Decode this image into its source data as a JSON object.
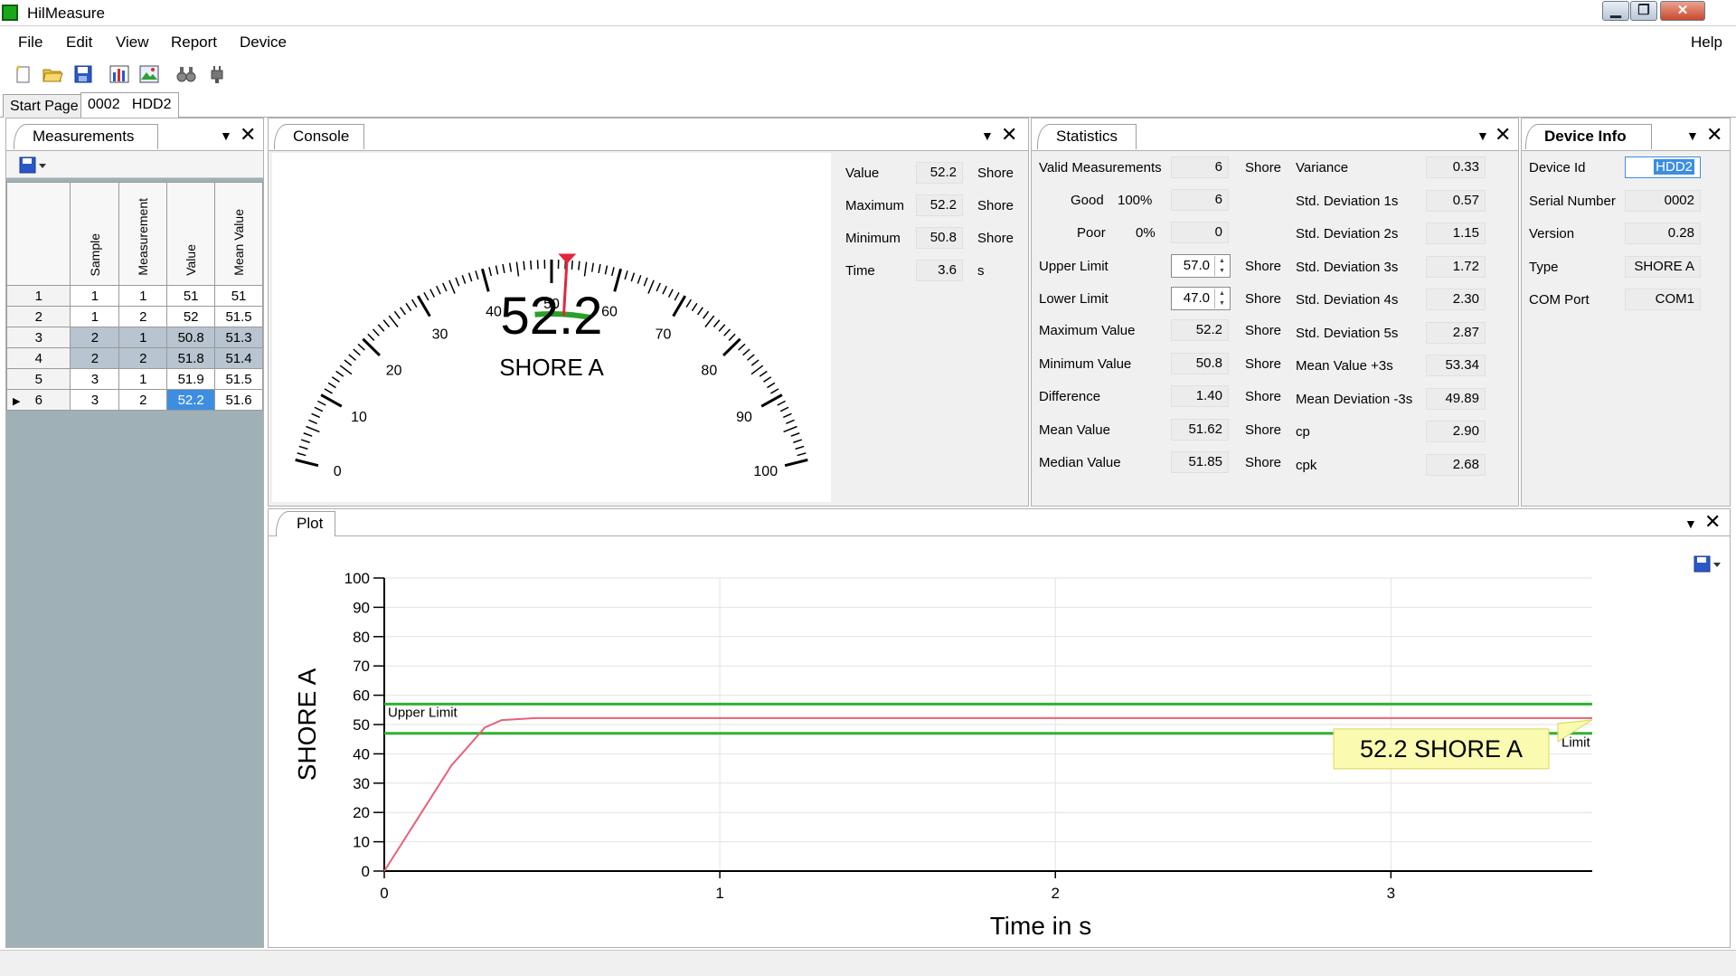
{
  "window": {
    "title": "HilMeasure",
    "controls": {
      "minimize": "▁",
      "maximize": "❐",
      "close": "✕"
    }
  },
  "menu": {
    "file": "File",
    "edit": "Edit",
    "view": "View",
    "report": "Report",
    "device": "Device",
    "help": "Help"
  },
  "toolbar": {
    "icons": [
      "new-file-icon",
      "open-folder-icon",
      "save-icon",
      "bar-chart-icon",
      "image-chart-icon",
      "binoculars-icon",
      "plug-icon"
    ]
  },
  "doc_tabs": {
    "start": "Start Page",
    "active": "0002   HDD2"
  },
  "measurements": {
    "title": "Measurements",
    "headers": [
      "Sample",
      "Measurement",
      "Value",
      "Mean Value"
    ],
    "rows": [
      {
        "n": "1",
        "sample": "1",
        "measurement": "1",
        "value": "51",
        "mean": "51"
      },
      {
        "n": "2",
        "sample": "1",
        "measurement": "2",
        "value": "52",
        "mean": "51.5"
      },
      {
        "n": "3",
        "sample": "2",
        "measurement": "1",
        "value": "50.8",
        "mean": "51.3"
      },
      {
        "n": "4",
        "sample": "2",
        "measurement": "2",
        "value": "51.8",
        "mean": "51.4"
      },
      {
        "n": "5",
        "sample": "3",
        "measurement": "1",
        "value": "51.9",
        "mean": "51.5"
      },
      {
        "n": "6",
        "sample": "3",
        "measurement": "2",
        "value": "52.2",
        "mean": "51.6"
      }
    ],
    "current_row_marker": "▶"
  },
  "console": {
    "title": "Console",
    "gauge": {
      "min": 0,
      "max": 100,
      "value": 52.2,
      "tolerance_low": 47,
      "tolerance_high": 57,
      "tick_labels": [
        "0",
        "10",
        "20",
        "30",
        "40",
        "50",
        "60",
        "70",
        "80",
        "90",
        "100"
      ],
      "reading": "52.2",
      "unit": "SHORE A"
    },
    "fields": [
      {
        "label": "Value",
        "value": "52.2",
        "unit": "Shore"
      },
      {
        "label": "Maximum",
        "value": "52.2",
        "unit": "Shore"
      },
      {
        "label": "Minimum",
        "value": "50.8",
        "unit": "Shore"
      },
      {
        "label": "Time",
        "value": "3.6",
        "unit": "s"
      }
    ]
  },
  "statistics": {
    "title": "Statistics",
    "valid": {
      "label": "Valid Measurements",
      "value": "6",
      "unit": "Shore"
    },
    "good": {
      "label": "Good",
      "pct": "100%",
      "value": "6"
    },
    "poor": {
      "label": "Poor",
      "pct": "0%",
      "value": "0"
    },
    "upper": {
      "label": "Upper Limit",
      "value": "57.0",
      "unit": "Shore"
    },
    "lower": {
      "label": "Lower Limit",
      "value": "47.0",
      "unit": "Shore"
    },
    "left": [
      {
        "label": "Maximum Value",
        "value": "52.2",
        "unit": "Shore"
      },
      {
        "label": "Minimum Value",
        "value": "50.8",
        "unit": "Shore"
      },
      {
        "label": "Difference",
        "value": "1.40",
        "unit": "Shore"
      },
      {
        "label": "Mean Value",
        "value": "51.62",
        "unit": "Shore"
      },
      {
        "label": "Median Value",
        "value": "51.85",
        "unit": "Shore"
      }
    ],
    "right": [
      {
        "label": "Variance",
        "value": "0.33"
      },
      {
        "label": "Std. Deviation 1s",
        "value": "0.57"
      },
      {
        "label": "Std. Deviation 2s",
        "value": "1.15"
      },
      {
        "label": "Std. Deviation 3s",
        "value": "1.72"
      },
      {
        "label": "Std. Deviation 4s",
        "value": "2.30"
      },
      {
        "label": "Std. Deviation 5s",
        "value": "2.87"
      },
      {
        "label": "Mean Value +3s",
        "value": "53.34"
      },
      {
        "label": "Mean Deviation -3s",
        "value": "49.89"
      },
      {
        "label": "cp",
        "value": "2.90"
      },
      {
        "label": "cpk",
        "value": "2.68"
      }
    ]
  },
  "device_info": {
    "title": "Device Info",
    "fields": [
      {
        "label": "Device Id",
        "value": "HDD2"
      },
      {
        "label": "Serial Number",
        "value": "0002"
      },
      {
        "label": "Version",
        "value": "0.28"
      },
      {
        "label": "Type",
        "value": "SHORE A"
      },
      {
        "label": "COM Port",
        "value": "COM1"
      }
    ]
  },
  "plot": {
    "title": "Plot",
    "callout": "52.2 SHORE A",
    "upper_limit_label": "Upper Limit",
    "lower_limit_label": "Limit"
  },
  "chart_data": {
    "type": "line",
    "xlabel": "Time in s",
    "ylabel": "SHORE A",
    "xlim": [
      0,
      3.6
    ],
    "ylim": [
      0,
      100
    ],
    "x_ticks": [
      0,
      1,
      2,
      3
    ],
    "y_ticks": [
      0,
      10,
      20,
      30,
      40,
      50,
      60,
      70,
      80,
      90,
      100
    ],
    "grid": true,
    "series": [
      {
        "color": "#e8607a",
        "x": [
          0,
          0.1,
          0.2,
          0.3,
          0.35,
          0.45,
          1.0,
          2.0,
          3.0,
          3.6
        ],
        "y": [
          0,
          18,
          36,
          49,
          51.5,
          52.2,
          52.2,
          52.2,
          52.2,
          52.2
        ]
      }
    ],
    "limits": {
      "upper": 57,
      "lower": 47,
      "color": "#30b030"
    },
    "colors": {
      "accent": "#3d8ee0",
      "needle": "#e0283c",
      "tolerance": "#2aa02a",
      "callout_bg": "#fafab0"
    }
  }
}
